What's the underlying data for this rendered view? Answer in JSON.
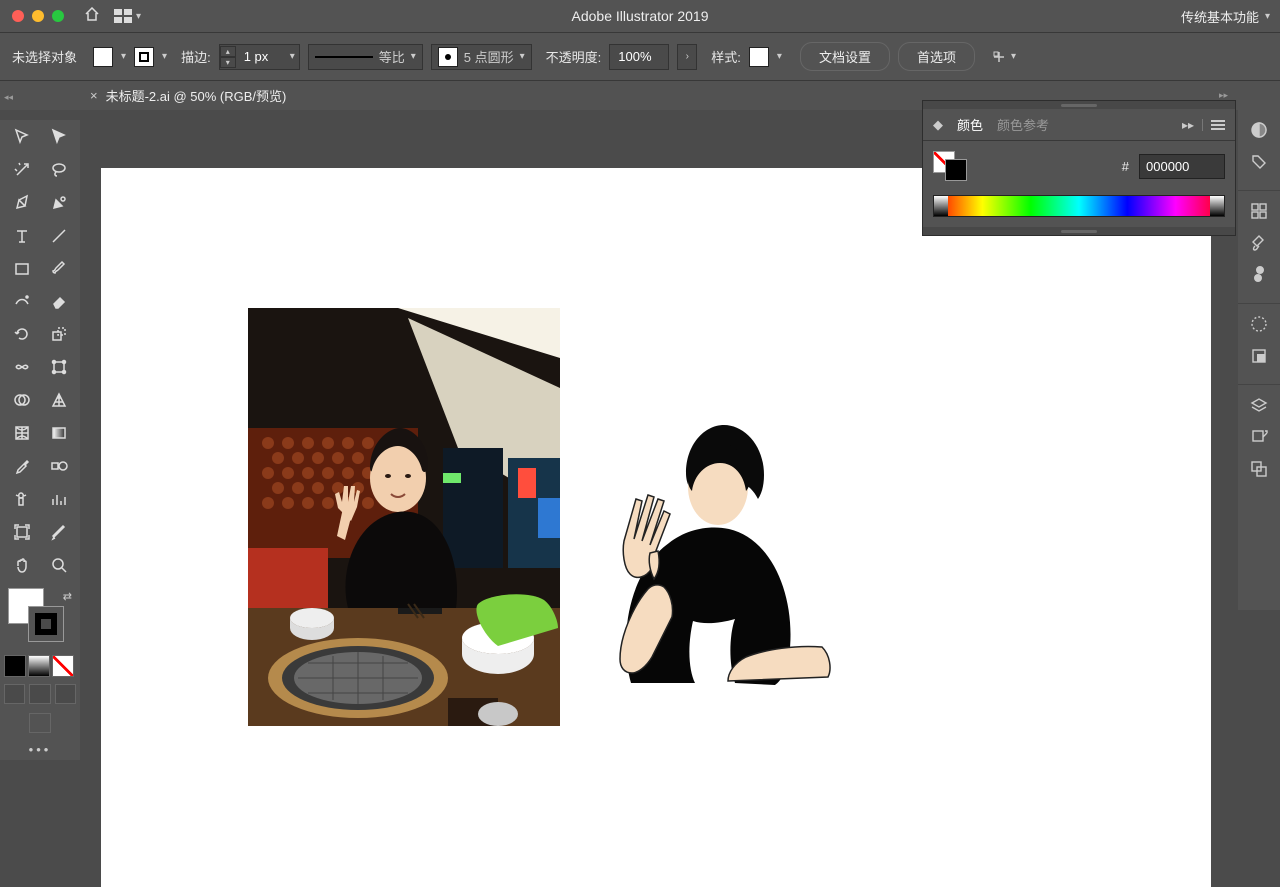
{
  "app_title": "Adobe Illustrator 2019",
  "workspace_label": "传统基本功能",
  "control": {
    "no_selection": "未选择对象",
    "stroke_label": "描边:",
    "stroke_width": "1 px",
    "dash_label": "等比",
    "profile_label": "5 点圆形",
    "opacity_label": "不透明度:",
    "opacity_value": "100%",
    "style_label": "样式:",
    "doc_setup": "文档设置",
    "prefs": "首选项"
  },
  "tab": {
    "name": "未标题-2.ai @ 50% (RGB/预览)"
  },
  "color_panel": {
    "tab_color": "颜色",
    "tab_guide": "颜色参考",
    "hex_prefix": "#",
    "hex_value": "000000"
  }
}
